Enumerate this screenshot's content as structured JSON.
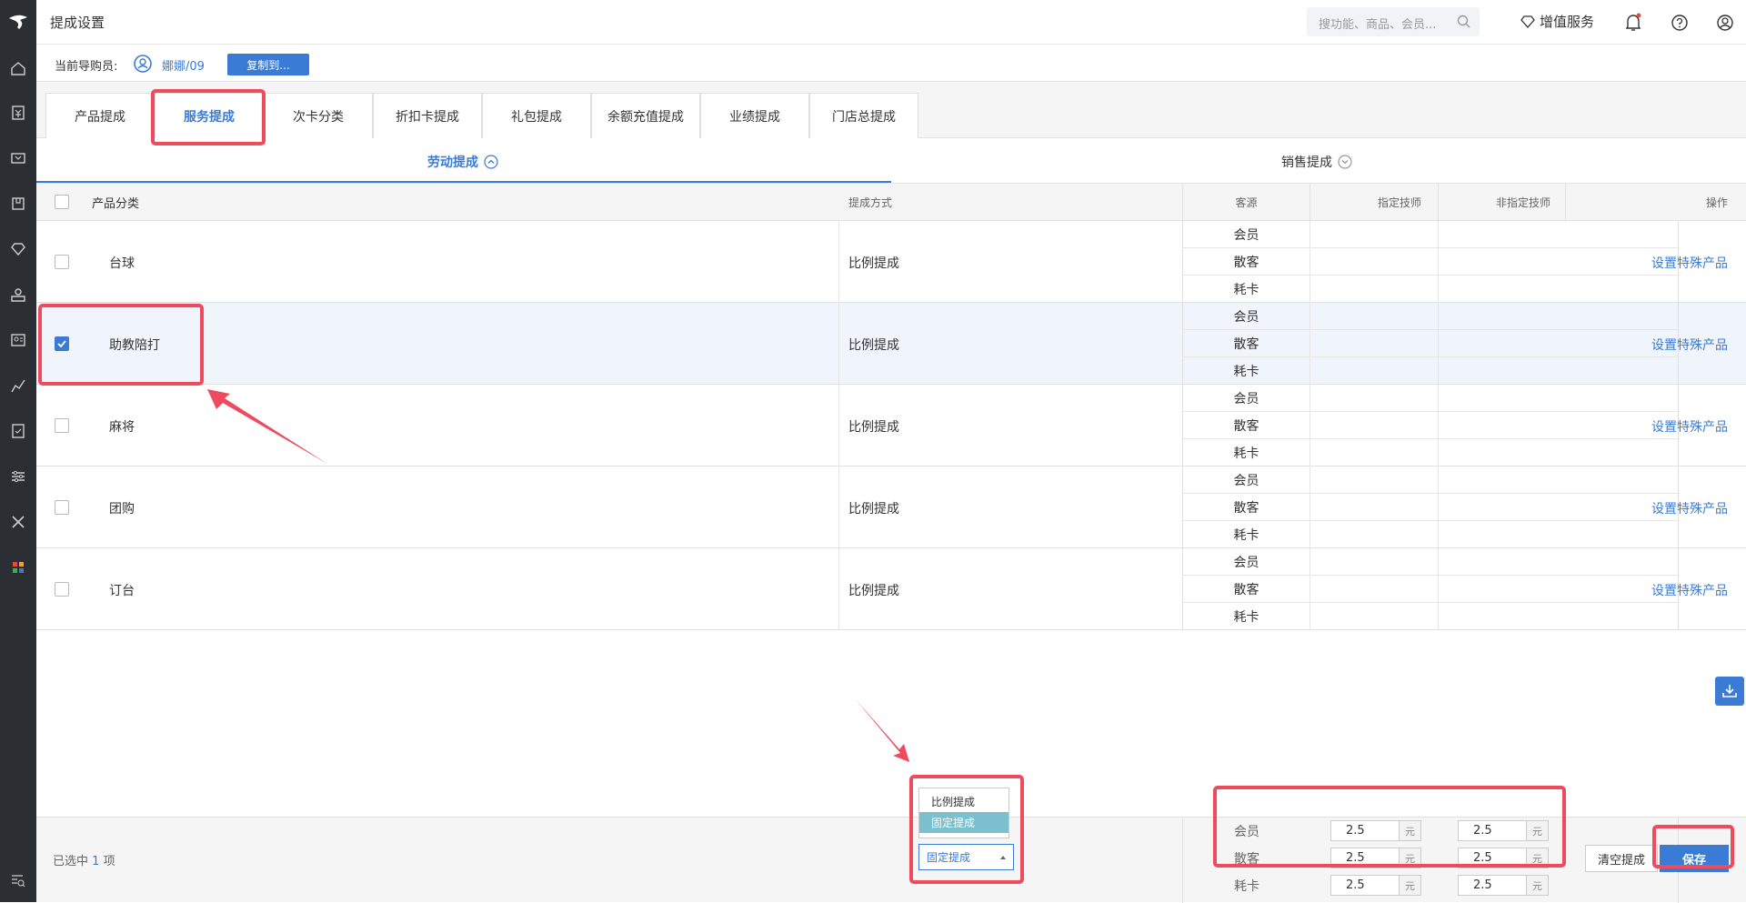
{
  "app": {
    "title": "提成设置",
    "search_placeholder": "搜功能、商品、会员...",
    "value_service": "增值服务"
  },
  "guide": {
    "label": "当前导购员:",
    "name": "娜娜/09",
    "copy_label": "复制到..."
  },
  "tabs": [
    "产品提成",
    "服务提成",
    "次卡分类",
    "折扣卡提成",
    "礼包提成",
    "余额充值提成",
    "业绩提成",
    "门店总提成"
  ],
  "active_tab": "服务提成",
  "subtabs": {
    "labor": "劳动提成",
    "sales": "销售提成"
  },
  "table": {
    "headers": {
      "category": "产品分类",
      "method": "提成方式",
      "source": "客源",
      "designated": "指定技师",
      "non_designated": "非指定技师",
      "action": "操作"
    },
    "source_labels": [
      "会员",
      "散客",
      "耗卡"
    ],
    "action_label": "设置特殊产品",
    "rows": [
      {
        "name": "台球",
        "method": "比例提成",
        "checked": false
      },
      {
        "name": "助教陪打",
        "method": "比例提成",
        "checked": true
      },
      {
        "name": "麻将",
        "method": "比例提成",
        "checked": false
      },
      {
        "name": "团购",
        "method": "比例提成",
        "checked": false
      },
      {
        "name": "订台",
        "method": "比例提成",
        "checked": false
      }
    ]
  },
  "footer": {
    "selected_prefix": "已选中",
    "selected_count": "1",
    "selected_suffix": "项",
    "method_select": "固定提成",
    "dropdown_options": [
      "比例提成",
      "固定提成"
    ],
    "rows": [
      {
        "label": "会员",
        "designated": "2.5",
        "non_designated": "2.5",
        "unit": "元"
      },
      {
        "label": "散客",
        "designated": "2.5",
        "non_designated": "2.5",
        "unit": "元"
      },
      {
        "label": "耗卡",
        "designated": "2.5",
        "non_designated": "2.5",
        "unit": "元"
      }
    ],
    "clear_label": "清空提成",
    "save_label": "保存"
  },
  "colors": {
    "accent": "#3a7bd5",
    "highlight": "#ef4b5f",
    "sidebar": "#2b2f33"
  }
}
